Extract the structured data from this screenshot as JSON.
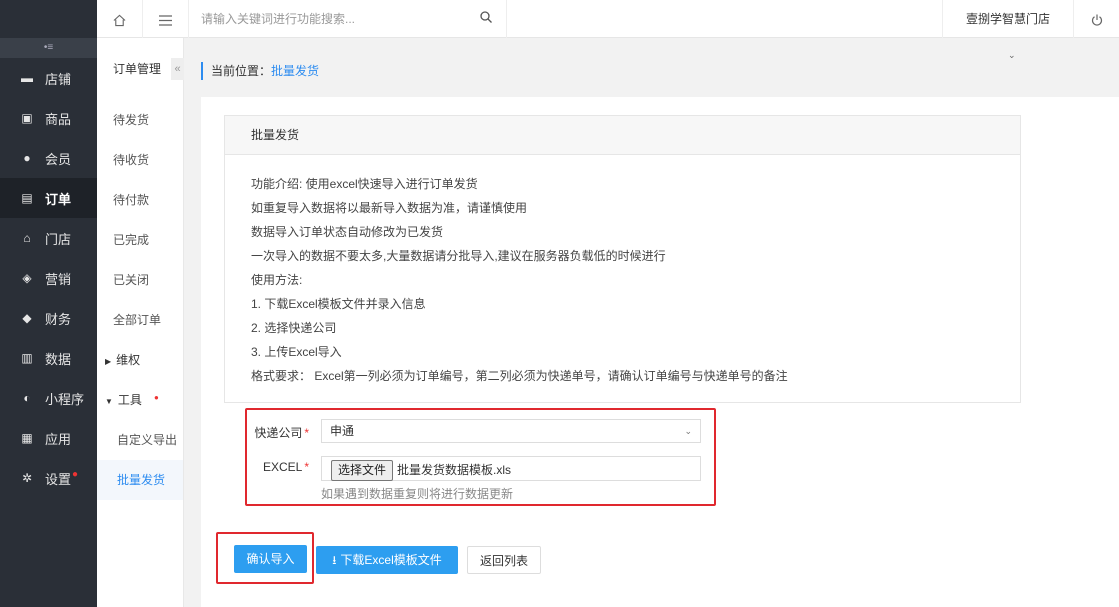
{
  "main_nav": {
    "items": [
      {
        "label": "店铺",
        "icon": "store-icon",
        "glyph": "▬"
      },
      {
        "label": "商品",
        "icon": "goods-icon",
        "glyph": "▣"
      },
      {
        "label": "会员",
        "icon": "user-icon",
        "glyph": "●"
      },
      {
        "label": "订单",
        "icon": "order-icon",
        "glyph": "▤"
      },
      {
        "label": "门店",
        "icon": "shop-icon",
        "glyph": "⌂"
      },
      {
        "label": "营销",
        "icon": "gift-icon",
        "glyph": "◈"
      },
      {
        "label": "财务",
        "icon": "finance-icon",
        "glyph": "◆"
      },
      {
        "label": "数据",
        "icon": "chart-icon",
        "glyph": "▥"
      },
      {
        "label": "小程序",
        "icon": "miniapp-icon",
        "glyph": "◐"
      },
      {
        "label": "应用",
        "icon": "apps-icon",
        "glyph": "▦"
      },
      {
        "label": "设置",
        "icon": "settings-icon",
        "glyph": "✲"
      }
    ],
    "active": "订单"
  },
  "sub_nav": {
    "title": "订单管理",
    "items": [
      "待发货",
      "待收货",
      "待付款",
      "已完成",
      "已关闭",
      "全部订单"
    ],
    "group_rights": "维权",
    "group_tools": "工具",
    "tools_children": [
      "自定义导出",
      "批量发货"
    ]
  },
  "header": {
    "search_placeholder": "请输入关键词进行功能搜索...",
    "store_name": "壹捌学智慧门店"
  },
  "breadcrumb": {
    "prefix": "当前位置：",
    "current": "批量发货"
  },
  "panel": {
    "title": "批量发货",
    "lines": [
      "功能介绍: 使用excel快速导入进行订单发货",
      "如重复导入数据将以最新导入数据为准，请谨慎使用",
      "数据导入订单状态自动修改为已发货",
      "一次导入的数据不要太多,大量数据请分批导入,建议在服务器负载低的时候进行",
      "使用方法:",
      "1. 下载Excel模板文件并录入信息",
      "2. 选择快递公司",
      "3. 上传Excel导入",
      "格式要求： Excel第一列必须为订单编号，第二列必须为快递单号，请确认订单编号与快递单号的备注"
    ]
  },
  "form": {
    "express_label": "快递公司",
    "express_value": "申通",
    "excel_label": "EXCEL",
    "file_button": "选择文件",
    "file_name": "批量发货数据模板.xls",
    "hint": "如果遇到数据重复则将进行数据更新",
    "required_mark": "*"
  },
  "actions": {
    "confirm": "确认导入",
    "download": "下载Excel模板文件",
    "back": "返回列表"
  },
  "colors": {
    "accent": "#2d9ef0",
    "highlight_border": "#e0282e",
    "sidebar_bg": "#2a2f37"
  }
}
